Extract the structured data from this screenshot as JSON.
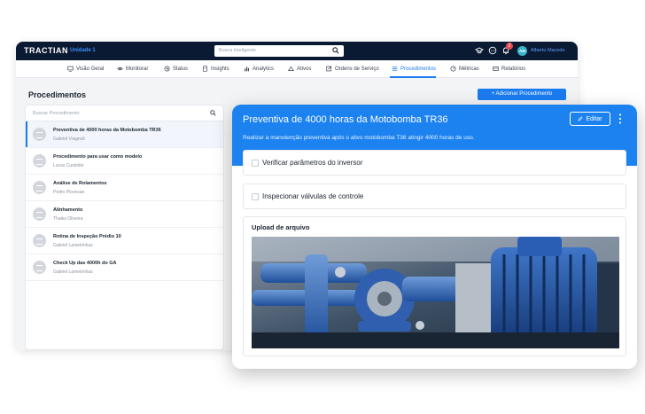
{
  "topbar": {
    "brand": "TRACTIAN",
    "unit": "Unidade 1",
    "search_placeholder": "Busca inteligente",
    "notification_count": "2",
    "avatar_initials": "AM",
    "username": "Alberto Macedo"
  },
  "nav": {
    "items": [
      {
        "label": "Visão Geral",
        "icon": "monitor-icon"
      },
      {
        "label": "Monitorar",
        "icon": "eye-icon"
      },
      {
        "label": "Status",
        "icon": "status-icon"
      },
      {
        "label": "Insights",
        "icon": "lightbulb-icon"
      },
      {
        "label": "Analytics",
        "icon": "bar-chart-icon"
      },
      {
        "label": "Ativos",
        "icon": "asset-icon"
      },
      {
        "label": "Ordens de Serviço",
        "icon": "edit-icon"
      },
      {
        "label": "Procedimentos",
        "icon": "list-icon"
      },
      {
        "label": "Métricas",
        "icon": "gauge-icon"
      },
      {
        "label": "Relatórios",
        "icon": "report-icon"
      }
    ],
    "active": "Procedimentos"
  },
  "procedures_page": {
    "title": "Procedimentos",
    "add_button": "+  Adicionar Procedimento",
    "search_placeholder": "Buscar Procedimento",
    "items": [
      {
        "name": "Preventiva de 4000 horas da Motobomba TR36",
        "author": "Gabriel Vragnoli",
        "selected": true
      },
      {
        "name": "Procedimento para usar como modelo",
        "author": "Lucas Custódio",
        "selected": false
      },
      {
        "name": "Análise de Rolamentos",
        "author": "Pedro Piovesan",
        "selected": false
      },
      {
        "name": "Alinhamento",
        "author": "Thales Oliveira",
        "selected": false
      },
      {
        "name": "Rotina de Inspeção Prédio 10",
        "author": "Gabriel Lameirinhas",
        "selected": false
      },
      {
        "name": "Check Up das 4000h do GA",
        "author": "Gabriel Lameirinhas",
        "selected": false
      }
    ]
  },
  "detail": {
    "title": "Preventiva de 4000 horas da Motobomba TR36",
    "edit_button": "Editar",
    "description": "Realizar a manutenção preventiva após o ativo motobomba T36 atingir 4000 horas de uso.",
    "tasks": [
      {
        "label": "Verificar parâmetros do inversor",
        "checked": false
      },
      {
        "label": "Inspecionar válvulas de controle",
        "checked": false
      }
    ],
    "upload_label": "Upload de arquivo"
  },
  "colors": {
    "primary": "#1b82f0",
    "topbar": "#0b1a33"
  }
}
